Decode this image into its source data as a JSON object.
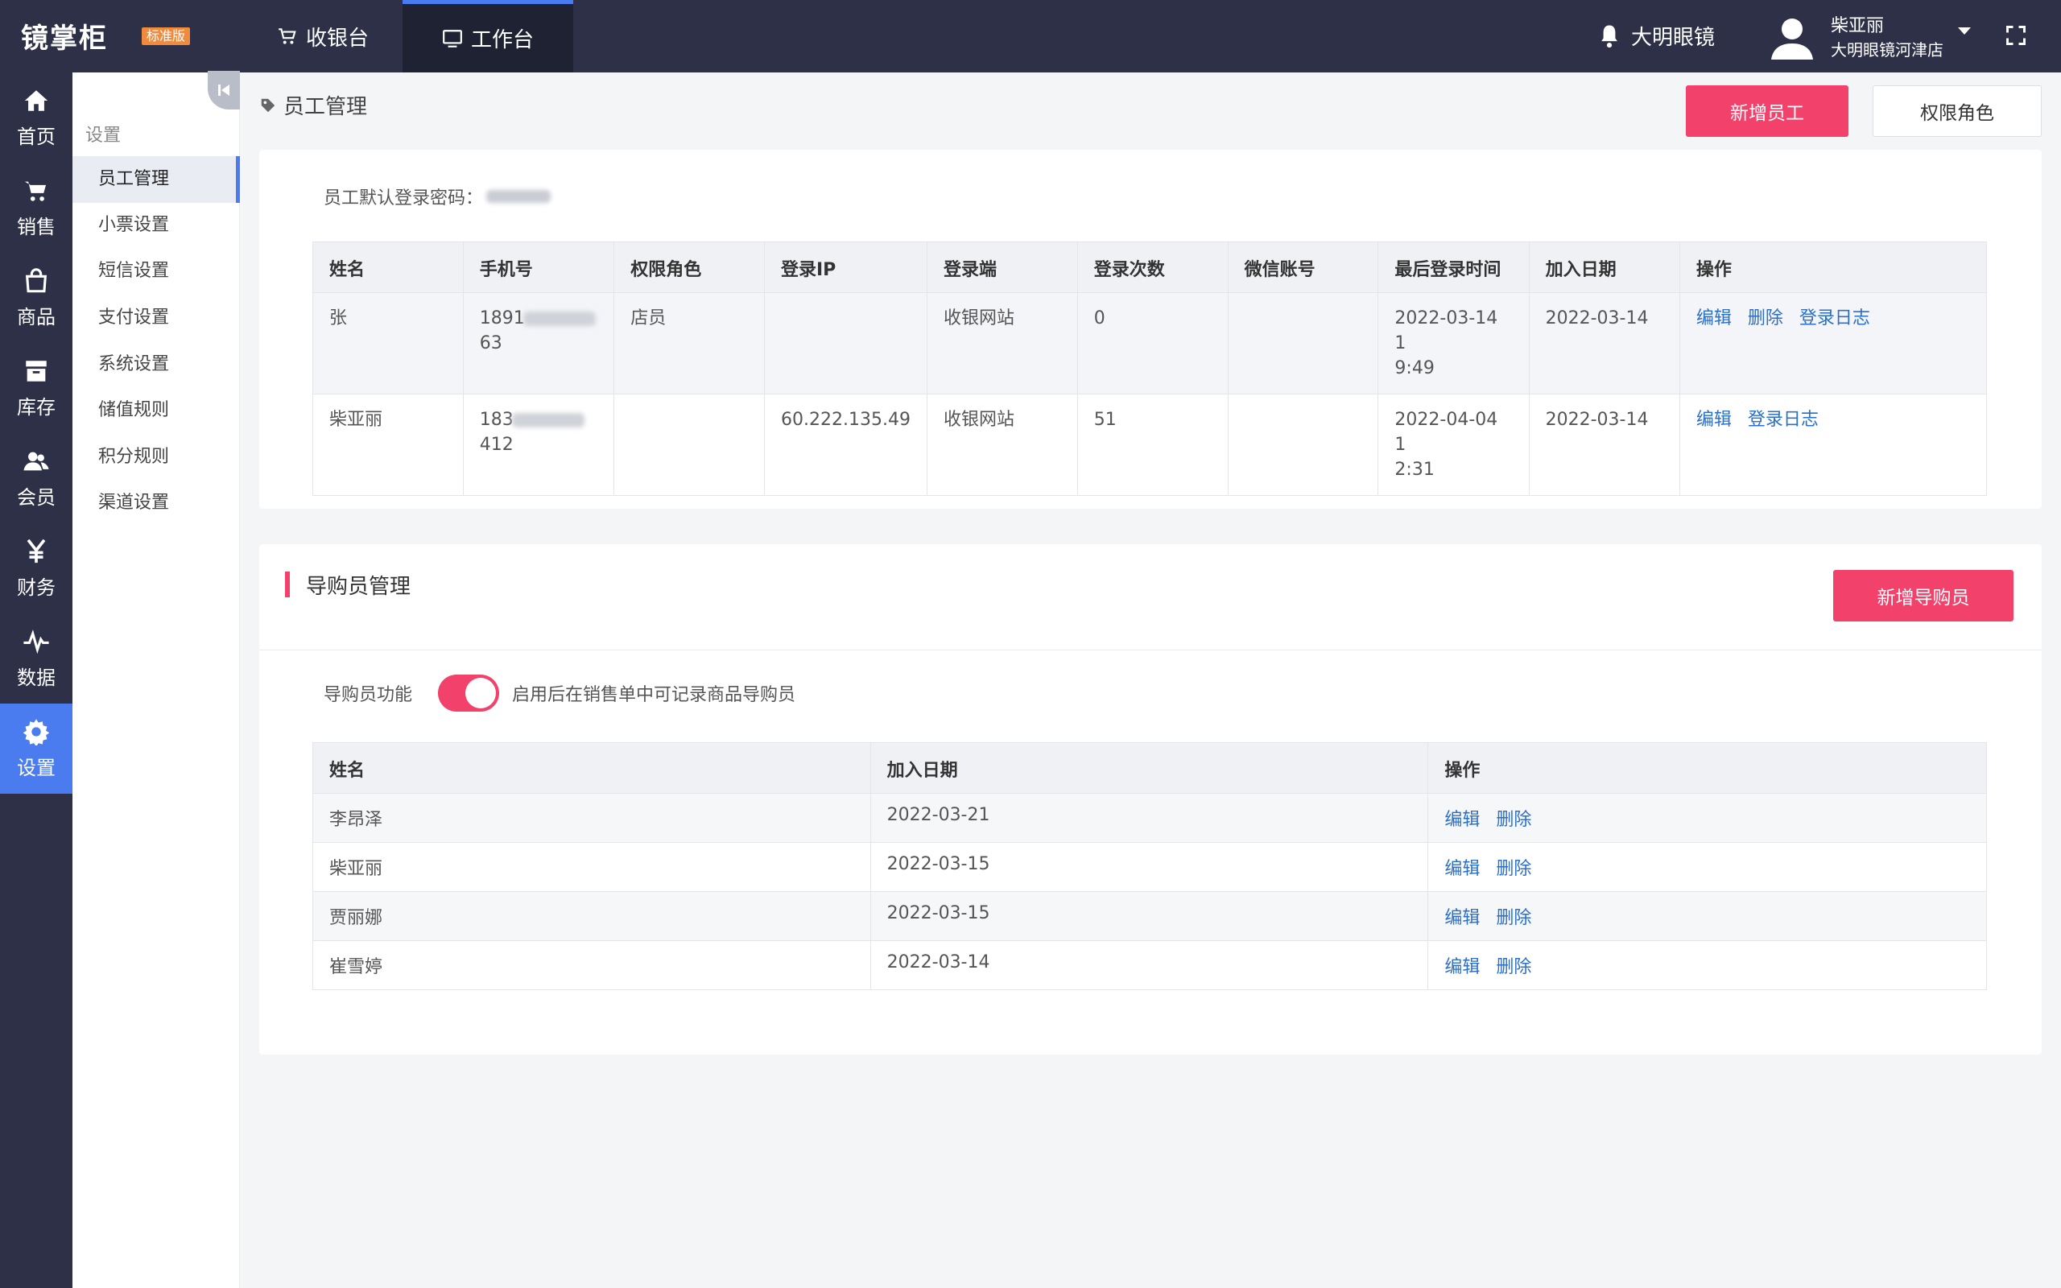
{
  "header": {
    "brand": "镜掌柜",
    "badge": "标准版",
    "nav": [
      {
        "label": "收银台",
        "icon": "cart-icon"
      },
      {
        "label": "工作台",
        "icon": "monitor-icon"
      }
    ],
    "notify_label": "大明眼镜",
    "user": {
      "name": "柴亚丽",
      "store": "大明眼镜河津店"
    }
  },
  "rail": [
    {
      "label": "首页",
      "icon": "home-icon"
    },
    {
      "label": "销售",
      "icon": "cart-icon"
    },
    {
      "label": "商品",
      "icon": "bag-icon"
    },
    {
      "label": "库存",
      "icon": "inventory-icon"
    },
    {
      "label": "会员",
      "icon": "members-icon"
    },
    {
      "label": "财务",
      "icon": "yen-icon"
    },
    {
      "label": "数据",
      "icon": "pulse-icon"
    },
    {
      "label": "设置",
      "icon": "gear-icon"
    }
  ],
  "submenu": {
    "title": "设置",
    "items": [
      "员工管理",
      "小票设置",
      "短信设置",
      "支付设置",
      "系统设置",
      "储值规则",
      "积分规则",
      "渠道设置"
    ]
  },
  "page": {
    "title": "员工管理",
    "btn_add_staff": "新增员工",
    "btn_roles": "权限角色"
  },
  "staff": {
    "default_pwd_label": "员工默认登录密码：",
    "columns": [
      "姓名",
      "手机号",
      "权限角色",
      "登录IP",
      "登录端",
      "登录次数",
      "微信账号",
      "最后登录时间",
      "加入日期",
      "操作"
    ],
    "rows": [
      {
        "name": "张",
        "phone_pre": "1891",
        "phone_post": "63",
        "role": "店员",
        "ip": "",
        "client": "收银网站",
        "count": "0",
        "wechat": "",
        "last_login_1": "2022-03-14 1",
        "last_login_2": "9:49",
        "joined": "2022-03-14",
        "ops": [
          "编辑",
          "删除",
          "登录日志"
        ]
      },
      {
        "name": "柴亚丽",
        "phone_pre": "183",
        "phone_post": "412",
        "role": "",
        "ip": "60.222.135.49",
        "client": "收银网站",
        "count": "51",
        "wechat": "",
        "last_login_1": "2022-04-04 1",
        "last_login_2": "2:31",
        "joined": "2022-03-14",
        "ops": [
          "编辑",
          "登录日志"
        ]
      }
    ]
  },
  "guides": {
    "title": "导购员管理",
    "btn_add": "新增导购员",
    "toggle_label": "导购员功能",
    "toggle_on": true,
    "toggle_hint": "启用后在销售单中可记录商品导购员",
    "columns": [
      "姓名",
      "加入日期",
      "操作"
    ],
    "rows": [
      {
        "name": "李昂泽",
        "joined": "2022-03-21",
        "ops": [
          "编辑",
          "删除"
        ]
      },
      {
        "name": "柴亚丽",
        "joined": "2022-03-15",
        "ops": [
          "编辑",
          "删除"
        ]
      },
      {
        "name": "贾丽娜",
        "joined": "2022-03-15",
        "ops": [
          "编辑",
          "删除"
        ]
      },
      {
        "name": "崔雪婷",
        "joined": "2022-03-14",
        "ops": [
          "编辑",
          "删除"
        ]
      }
    ]
  },
  "colors": {
    "primary": "#f2416a",
    "nav_bg": "#2d3047",
    "accent_blue": "#4a7cf0",
    "link": "#2a6fc9"
  }
}
